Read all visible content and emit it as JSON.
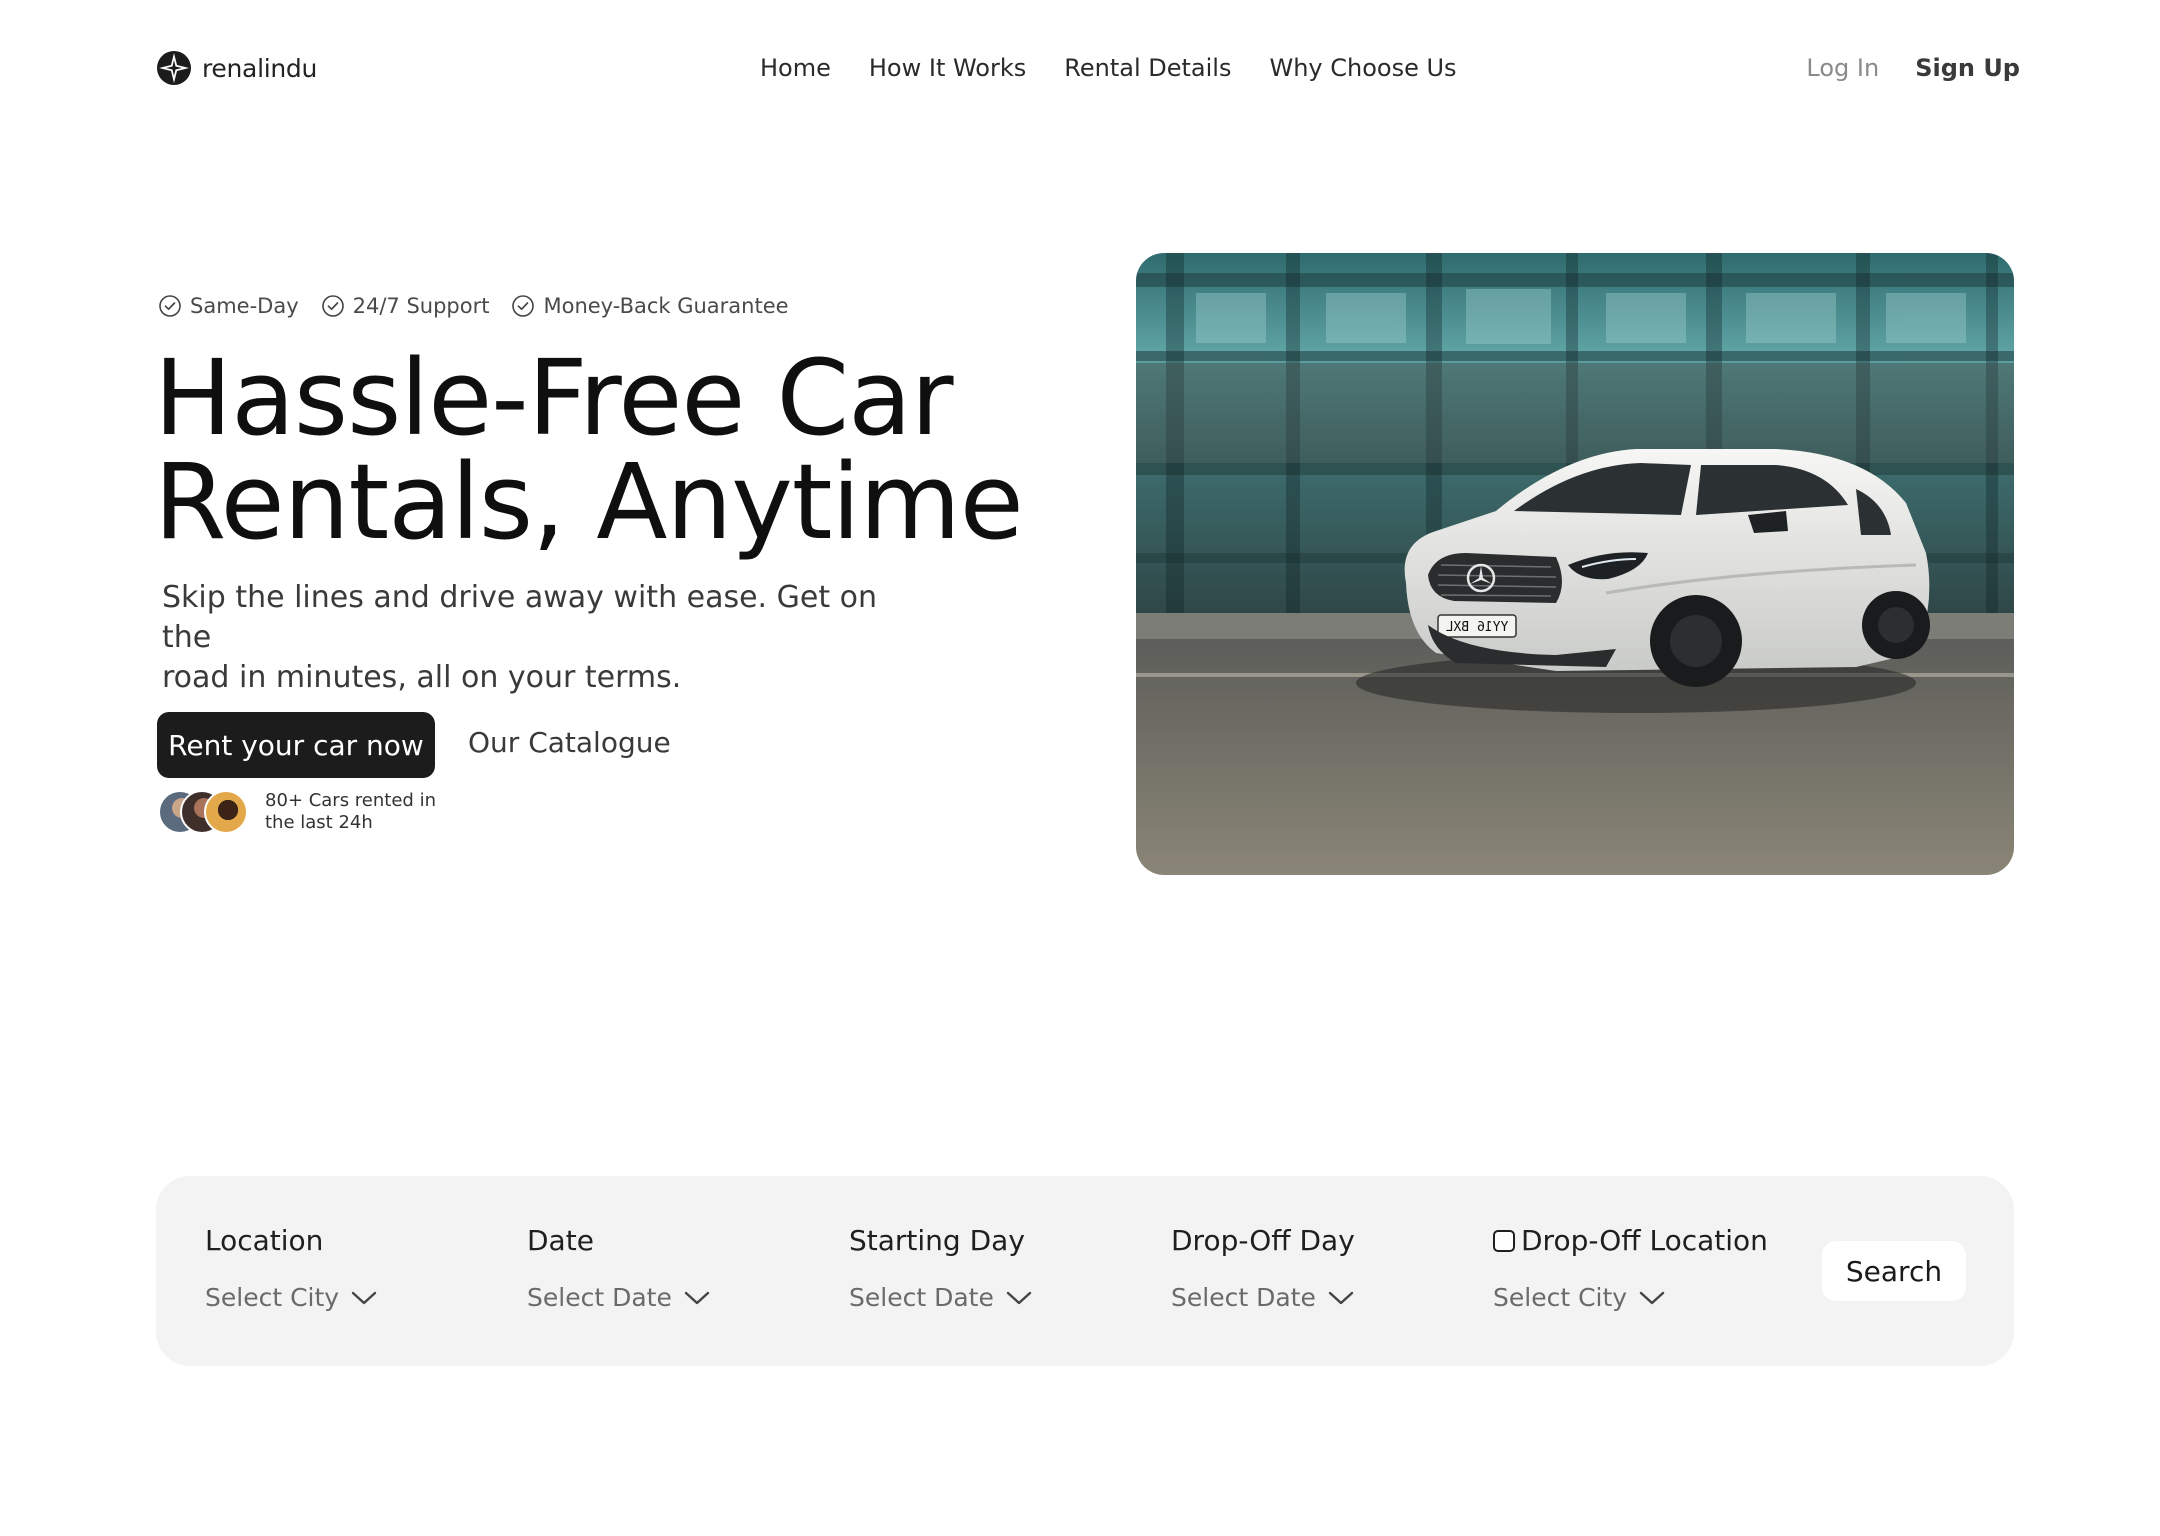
{
  "brand": {
    "name": "renalindu",
    "logo_icon": "compass-star-icon"
  },
  "nav": {
    "links": [
      "Home",
      "How It Works",
      "Rental Details",
      "Why Choose Us"
    ],
    "login": "Log In",
    "signup": "Sign Up"
  },
  "hero": {
    "features": [
      "Same-Day",
      "24/7 Support",
      "Money-Back Guarantee"
    ],
    "title_line1": "Hassle-Free Car",
    "title_line2": "Rentals, Anytime",
    "subtitle_line1": "Skip the lines and drive away with ease. Get on the",
    "subtitle_line2": "road in minutes, all on your terms.",
    "primary_cta": "Rent your car now",
    "secondary_cta": "Our Catalogue",
    "social_proof_line1": "80+ Cars rented in",
    "social_proof_line2": "the last 24h",
    "image_plate": "YY16 BXL"
  },
  "search": {
    "fields": [
      {
        "label": "Location",
        "value": "Select City"
      },
      {
        "label": "Date",
        "value": "Select Date"
      },
      {
        "label": "Starting Day",
        "value": "Select Date"
      },
      {
        "label": "Drop-Off Day",
        "value": "Select Date"
      },
      {
        "label": "Drop-Off Location",
        "value": "Select City",
        "checkbox": true
      }
    ],
    "button": "Search"
  },
  "colors": {
    "primary": "#1c1c1c",
    "bar_bg": "#f3f3f3",
    "muted": "#8a8a8a"
  }
}
